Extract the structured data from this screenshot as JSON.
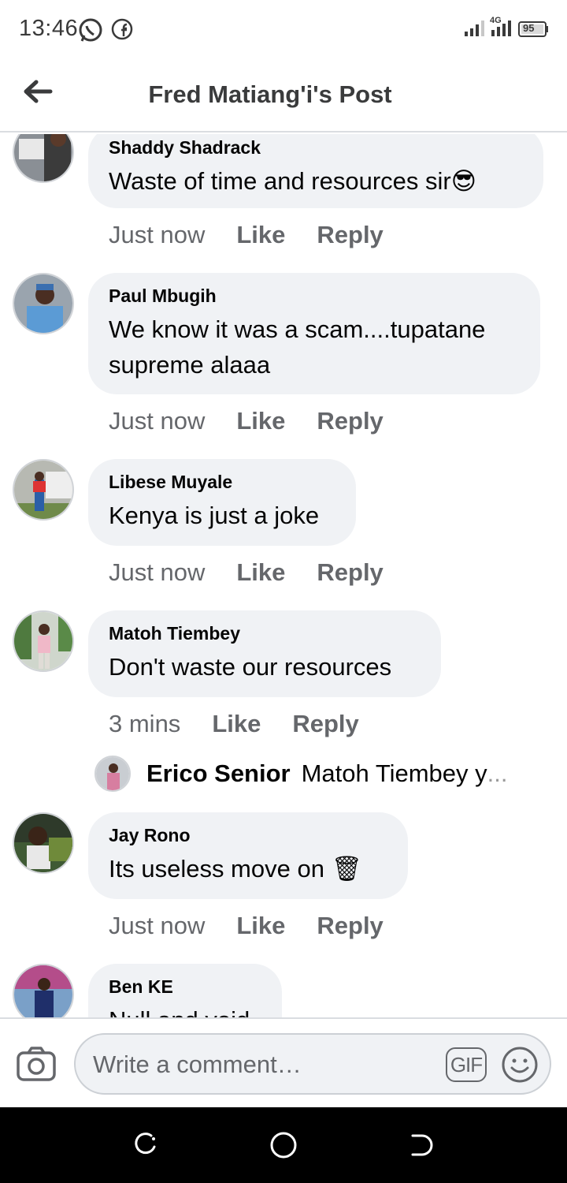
{
  "status": {
    "time": "13:46",
    "network": "4G",
    "battery": "95"
  },
  "header": {
    "title": "Fred Matiang'i's Post"
  },
  "comments": [
    {
      "author": "Shaddy Shadrack",
      "text": "Waste of time and resources sir",
      "emoji": "😎",
      "time": "Just now",
      "like": "Like",
      "reply": "Reply"
    },
    {
      "author": "Paul Mbugih",
      "line1": "We know it was a scam....tupatane",
      "line2": "supreme alaaa",
      "time": "Just now",
      "like": "Like",
      "reply": "Reply"
    },
    {
      "author": "Libese Muyale",
      "text": "Kenya is just a joke",
      "time": "Just now",
      "like": "Like",
      "reply": "Reply"
    },
    {
      "author": "Matoh Tiembey",
      "text": "Don't waste our resources",
      "time": "3 mins",
      "like": "Like",
      "reply": "Reply"
    },
    {
      "author": "Jay Rono",
      "text": "Its useless move on",
      "emoji": "🗑",
      "time": "Just now",
      "like": "Like",
      "reply": "Reply"
    },
    {
      "author": "Ben KE",
      "text": "Null and void"
    }
  ],
  "reply_preview": {
    "author": "Erico Senior",
    "text": "Matoh Tiembey y",
    "ellipsis": "..."
  },
  "composer": {
    "placeholder": "Write a comment…",
    "gif_label": "GIF"
  },
  "icons": {
    "back": "arrow-left-icon",
    "camera": "camera-icon",
    "emoji": "smiley-icon",
    "whatsapp": "whatsapp-icon",
    "facebook": "facebook-icon"
  }
}
